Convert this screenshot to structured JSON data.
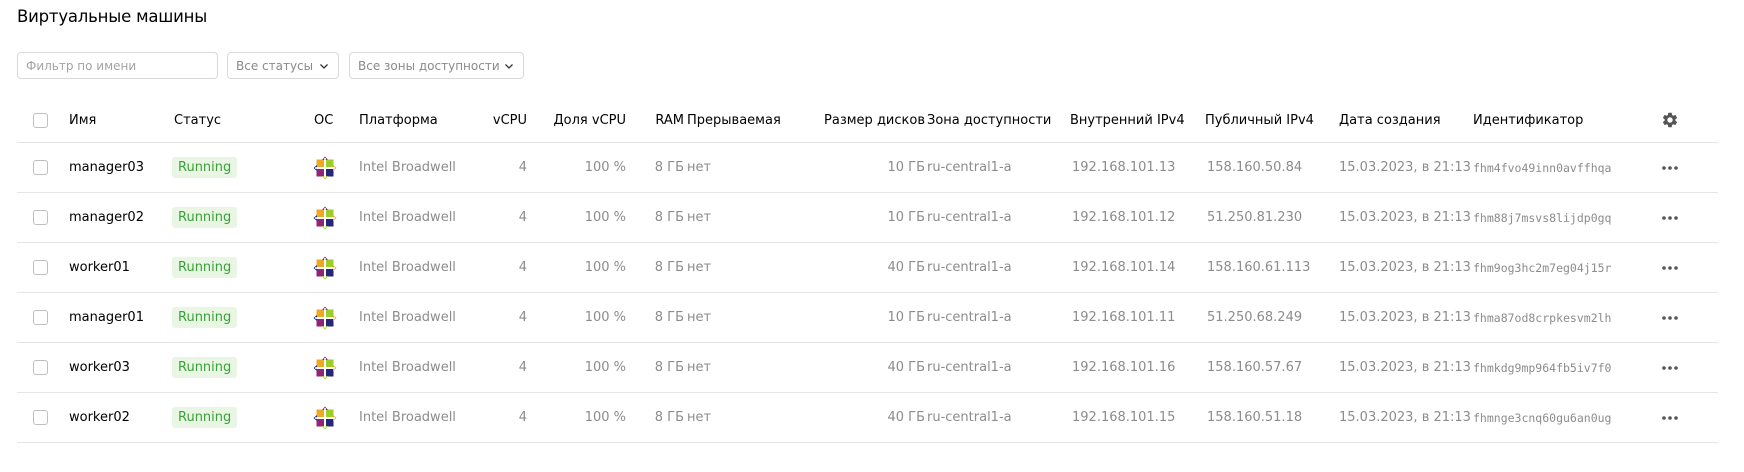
{
  "page": {
    "title": "Виртуальные машины"
  },
  "filters": {
    "name_placeholder": "Фильтр по имени",
    "status_label": "Все статусы",
    "zone_label": "Все зоны доступности"
  },
  "columns": {
    "name": "Имя",
    "status": "Статус",
    "os": "ОС",
    "platform": "Платформа",
    "vcpu": "vCPU",
    "vcpu_share": "Доля vCPU",
    "ram": "RAM",
    "preemptible": "Прерываемая",
    "disk_size": "Размер дисков",
    "zone": "Зона доступности",
    "internal_ip": "Внутренний IPv4",
    "public_ip": "Публичный IPv4",
    "created": "Дата создания",
    "id": "Идентификатор"
  },
  "rows": [
    {
      "name": "manager03",
      "status": "Running",
      "os_icon": "centos-icon",
      "platform": "Intel Broadwell",
      "vcpu": "4",
      "vcpu_share": "100 %",
      "ram": "8 ГБ",
      "preemptible": "нет",
      "disk_size": "10 ГБ",
      "zone": "ru-central1-a",
      "internal_ip": "192.168.101.13",
      "public_ip": "158.160.50.84",
      "created": "15.03.2023, в 21:13",
      "id": "fhm4fvo49inn0avffhqa"
    },
    {
      "name": "manager02",
      "status": "Running",
      "os_icon": "centos-icon",
      "platform": "Intel Broadwell",
      "vcpu": "4",
      "vcpu_share": "100 %",
      "ram": "8 ГБ",
      "preemptible": "нет",
      "disk_size": "10 ГБ",
      "zone": "ru-central1-a",
      "internal_ip": "192.168.101.12",
      "public_ip": "51.250.81.230",
      "created": "15.03.2023, в 21:13",
      "id": "fhm88j7msvs8lijdp0gq"
    },
    {
      "name": "worker01",
      "status": "Running",
      "os_icon": "centos-icon",
      "platform": "Intel Broadwell",
      "vcpu": "4",
      "vcpu_share": "100 %",
      "ram": "8 ГБ",
      "preemptible": "нет",
      "disk_size": "40 ГБ",
      "zone": "ru-central1-a",
      "internal_ip": "192.168.101.14",
      "public_ip": "158.160.61.113",
      "created": "15.03.2023, в 21:13",
      "id": "fhm9og3hc2m7eg04j15r"
    },
    {
      "name": "manager01",
      "status": "Running",
      "os_icon": "centos-icon",
      "platform": "Intel Broadwell",
      "vcpu": "4",
      "vcpu_share": "100 %",
      "ram": "8 ГБ",
      "preemptible": "нет",
      "disk_size": "10 ГБ",
      "zone": "ru-central1-a",
      "internal_ip": "192.168.101.11",
      "public_ip": "51.250.68.249",
      "created": "15.03.2023, в 21:13",
      "id": "fhma87od8crpkesvm2lh"
    },
    {
      "name": "worker03",
      "status": "Running",
      "os_icon": "centos-icon",
      "platform": "Intel Broadwell",
      "vcpu": "4",
      "vcpu_share": "100 %",
      "ram": "8 ГБ",
      "preemptible": "нет",
      "disk_size": "40 ГБ",
      "zone": "ru-central1-a",
      "internal_ip": "192.168.101.16",
      "public_ip": "158.160.57.67",
      "created": "15.03.2023, в 21:13",
      "id": "fhmkdg9mp964fb5iv7f0"
    },
    {
      "name": "worker02",
      "status": "Running",
      "os_icon": "centos-icon",
      "platform": "Intel Broadwell",
      "vcpu": "4",
      "vcpu_share": "100 %",
      "ram": "8 ГБ",
      "preemptible": "нет",
      "disk_size": "40 ГБ",
      "zone": "ru-central1-a",
      "internal_ip": "192.168.101.15",
      "public_ip": "158.160.51.18",
      "created": "15.03.2023, в 21:13",
      "id": "fhmnge3cnq60gu6an0ug"
    }
  ],
  "colors": {
    "running_bg": "#e8f6e3",
    "running_text": "#3aa13a",
    "border": "#e5e5e5",
    "muted": "#8c8c8c"
  }
}
